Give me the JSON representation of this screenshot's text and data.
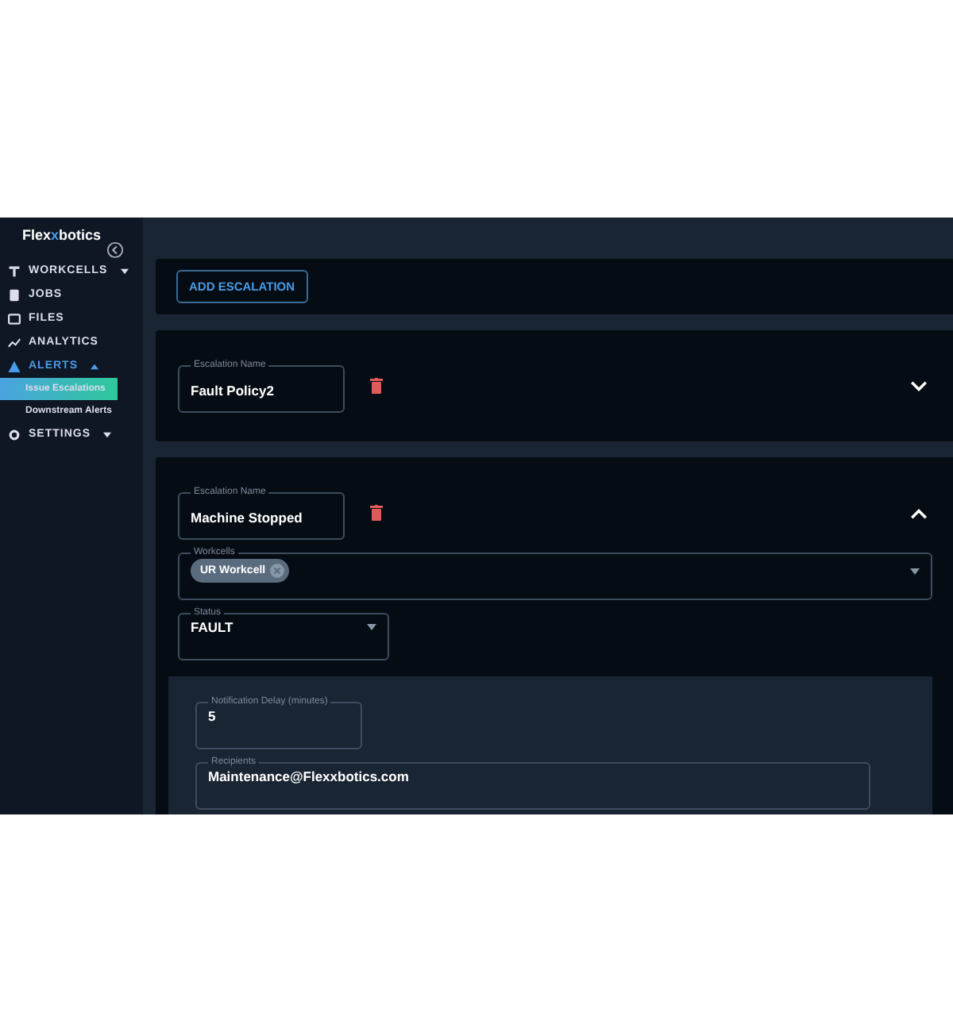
{
  "logo": {
    "before": "Flex",
    "accent": "x",
    "after": "botics"
  },
  "sidebar": {
    "items": [
      {
        "label": "WORKCELLS",
        "kind": "group",
        "selected": false,
        "expanded": false
      },
      {
        "label": "JOBS",
        "kind": "link",
        "selected": false
      },
      {
        "label": "FILES",
        "kind": "link",
        "selected": false
      },
      {
        "label": "ANALYTICS",
        "kind": "link",
        "selected": false
      },
      {
        "label": "ALERTS",
        "kind": "group",
        "selected": true,
        "expanded": true,
        "children": [
          {
            "label": "Issue Escalations",
            "selected": true
          },
          {
            "label": "Downstream Alerts",
            "selected": false
          }
        ]
      },
      {
        "label": "SETTINGS",
        "kind": "group",
        "selected": false,
        "expanded": false
      }
    ]
  },
  "add_button": "ADD ESCALATION",
  "escalations": [
    {
      "name_label": "Escalation Name",
      "name": "Fault Policy2",
      "expanded": false
    },
    {
      "name_label": "Escalation Name",
      "name": "Machine Stopped",
      "expanded": true,
      "workcells_label": "Workcells",
      "workcells": [
        "UR Workcell"
      ],
      "status_label": "Status",
      "status": "FAULT",
      "delay_label": "Notification Delay (minutes)",
      "delay": "5",
      "recipients_label": "Recipients",
      "recipients": "Maintenance@Flexxbotics.com"
    }
  ]
}
